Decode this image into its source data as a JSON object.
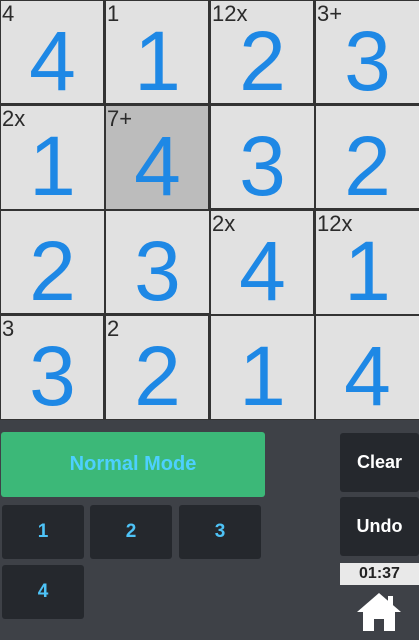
{
  "grid": {
    "rows": [
      [
        {
          "clue": "4",
          "value": "4"
        },
        {
          "clue": "1",
          "value": "1"
        },
        {
          "clue": "12x",
          "value": "2"
        },
        {
          "clue": "3+",
          "value": "3"
        }
      ],
      [
        {
          "clue": "2x",
          "value": "1"
        },
        {
          "clue": "7+",
          "value": "4",
          "selected": true
        },
        {
          "clue": "",
          "value": "3"
        },
        {
          "clue": "",
          "value": "2"
        }
      ],
      [
        {
          "clue": "",
          "value": "2"
        },
        {
          "clue": "",
          "value": "3"
        },
        {
          "clue": "2x",
          "value": "4"
        },
        {
          "clue": "12x",
          "value": "1"
        }
      ],
      [
        {
          "clue": "3",
          "value": "3"
        },
        {
          "clue": "2",
          "value": "2"
        },
        {
          "clue": "",
          "value": "1"
        },
        {
          "clue": "",
          "value": "4"
        }
      ]
    ]
  },
  "controls": {
    "mode_label": "Normal Mode",
    "numbers": [
      "1",
      "2",
      "3",
      "4"
    ],
    "clear_label": "Clear",
    "undo_label": "Undo",
    "timer": "01:37"
  },
  "colors": {
    "value": "#1e88e5",
    "mode_button": "#3cb878",
    "button_bg": "#25282d",
    "background": "#3e4147",
    "selected_cell": "#bcbcbc"
  },
  "icons": {
    "home": "home-icon"
  }
}
